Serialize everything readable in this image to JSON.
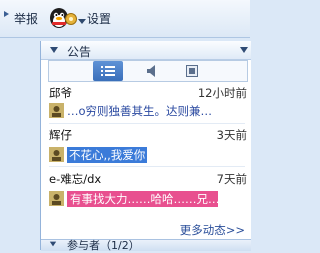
{
  "toolbar": {
    "report_label": "举报",
    "settings_label": "设置"
  },
  "notice": {
    "header": "公告",
    "items": [
      {
        "name": "邱爷",
        "time": "12小时前",
        "message": "…o穷则独善其生。达则兼…"
      },
      {
        "name": "辉仔",
        "time": "3天前",
        "message": "不花心,,我爱你"
      },
      {
        "name": "e-难忘/dx",
        "time": "7天前",
        "message": "有事找大力……哈哈……兄…"
      }
    ],
    "more_label": "更多动态>>"
  },
  "bottom_bar": {
    "label": "参与者（1/2）"
  },
  "colors": {
    "accent_blue": "#3b7bd9",
    "highlight_pink": "#e8508f",
    "link_blue": "#2b4f9a"
  }
}
